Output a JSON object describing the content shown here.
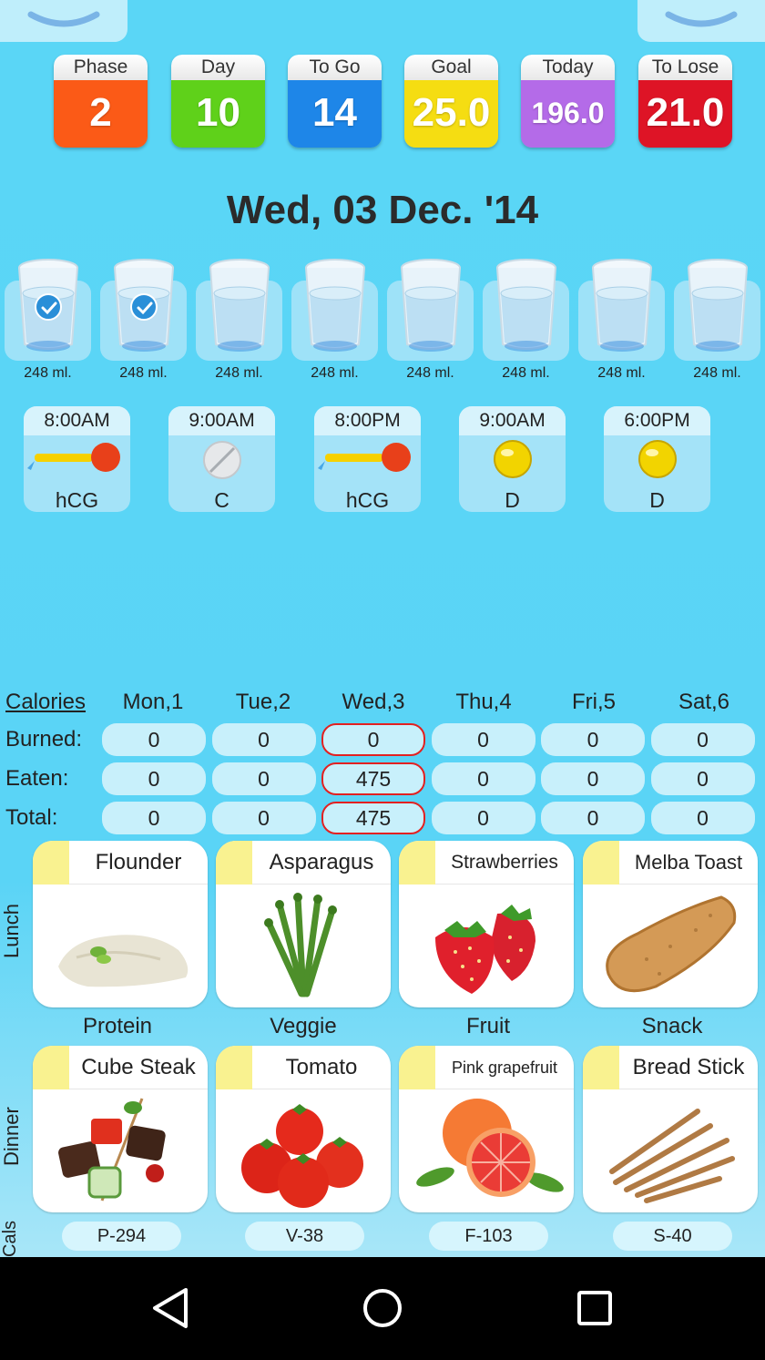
{
  "stats": [
    {
      "label": "Phase",
      "value": "2",
      "color": "#fb5a17"
    },
    {
      "label": "Day",
      "value": "10",
      "color": "#5fd11a"
    },
    {
      "label": "To Go",
      "value": "14",
      "color": "#1e86e8"
    },
    {
      "label": "Goal",
      "value": "25.0",
      "color": "#f5dd12"
    },
    {
      "label": "Today",
      "value": "196.0",
      "color": "#b46be8"
    },
    {
      "label": "To Lose",
      "value": "21.0",
      "color": "#de1426"
    }
  ],
  "date": "Wed, 03 Dec. '14",
  "water": [
    {
      "ml": "248 ml.",
      "checked": true
    },
    {
      "ml": "248 ml.",
      "checked": true
    },
    {
      "ml": "248 ml.",
      "checked": false
    },
    {
      "ml": "248 ml.",
      "checked": false
    },
    {
      "ml": "248 ml.",
      "checked": false
    },
    {
      "ml": "248 ml.",
      "checked": false
    },
    {
      "ml": "248 ml.",
      "checked": false
    },
    {
      "ml": "248 ml.",
      "checked": false
    }
  ],
  "supplements": [
    {
      "time": "8:00AM",
      "name": "hCG",
      "icon": "dropper-icon"
    },
    {
      "time": "9:00AM",
      "name": "C",
      "icon": "pill-icon"
    },
    {
      "time": "8:00PM",
      "name": "hCG",
      "icon": "dropper-icon"
    },
    {
      "time": "9:00AM",
      "name": "D",
      "icon": "softgel-icon"
    },
    {
      "time": "6:00PM",
      "name": "D",
      "icon": "softgel-icon"
    }
  ],
  "calories": {
    "title": "Calories",
    "days": [
      "Mon,1",
      "Tue,2",
      "Wed,3",
      "Thu,4",
      "Fri,5",
      "Sat,6"
    ],
    "rows": [
      {
        "label": "Burned:",
        "values": [
          "0",
          "0",
          "0",
          "0",
          "0",
          "0"
        ]
      },
      {
        "label": "Eaten:",
        "values": [
          "0",
          "0",
          "475",
          "0",
          "0",
          "0"
        ]
      },
      {
        "label": "Total:",
        "values": [
          "0",
          "0",
          "475",
          "0",
          "0",
          "0"
        ]
      }
    ],
    "today_index": 2,
    "today_border_color": "#e32020"
  },
  "meals": {
    "lunch_label": "Lunch",
    "dinner_label": "Dinner",
    "cals_label": "Cals",
    "categories": [
      "Protein",
      "Veggie",
      "Fruit",
      "Snack"
    ],
    "lunch": [
      "Flounder",
      "Asparagus",
      "Strawberries",
      "Melba Toast"
    ],
    "dinner": [
      "Cube Steak",
      "Tomato",
      "Pink grapefruit",
      "Bread Stick"
    ],
    "cals": [
      "P-294",
      "V-38",
      "F-103",
      "S-40"
    ]
  },
  "icons": {
    "top_left": "chevron-down-icon",
    "top_right": "chevron-down-icon",
    "nav_back": "back-triangle-icon",
    "nav_home": "home-circle-icon",
    "nav_recents": "recents-square-icon"
  }
}
